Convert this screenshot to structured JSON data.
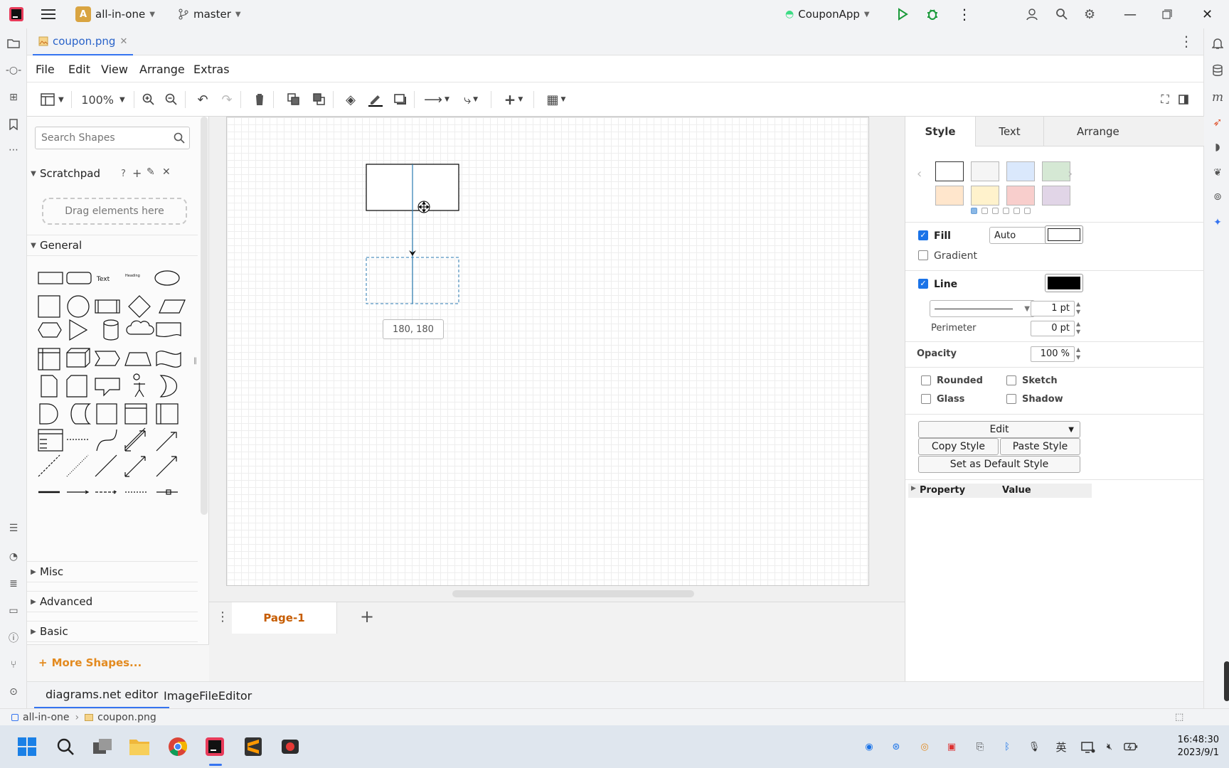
{
  "ide": {
    "project": "all-in-one",
    "project_badge": "A",
    "branch": "master",
    "run_config": "CouponApp"
  },
  "editor_tab": {
    "filename": "coupon.png"
  },
  "menu": [
    "File",
    "Edit",
    "View",
    "Arrange",
    "Extras"
  ],
  "toolbar": {
    "zoom": "100%"
  },
  "sidebar": {
    "search_placeholder": "Search Shapes",
    "scratchpad": {
      "title": "Scratchpad",
      "help": "?",
      "drop_hint": "Drag elements here"
    },
    "general": {
      "title": "General",
      "text_shape": "Text",
      "heading_shape": "Heading"
    },
    "collapsed_sections": [
      "Misc",
      "Advanced",
      "Basic"
    ],
    "more_shapes": "More Shapes..."
  },
  "canvas": {
    "size_tooltip": "180, 180"
  },
  "pages": {
    "tabs": [
      "Page-1"
    ]
  },
  "format": {
    "tabs": [
      "Style",
      "Text",
      "Arrange"
    ],
    "swatches": [
      "#ffffff",
      "#f5f5f5",
      "#dae8fc",
      "#d5e8d4",
      "#ffe6cc",
      "#fff2cc",
      "#f8cecc",
      "#e1d5e7"
    ],
    "fill": {
      "label": "Fill",
      "checked": true,
      "mode": "Auto",
      "color": "#ffffff"
    },
    "gradient": {
      "label": "Gradient",
      "checked": false
    },
    "line": {
      "label": "Line",
      "checked": true,
      "color": "#000000",
      "width": "1 pt"
    },
    "perimeter": {
      "label": "Perimeter",
      "value": "0 pt"
    },
    "opacity": {
      "label": "Opacity",
      "value": "100 %"
    },
    "options": {
      "rounded": "Rounded",
      "sketch": "Sketch",
      "glass": "Glass",
      "shadow": "Shadow"
    },
    "edit_label": "Edit",
    "copy_style": "Copy Style",
    "paste_style": "Paste Style",
    "set_default": "Set as Default Style",
    "property_header": "Property",
    "value_header": "Value"
  },
  "bottom_tabs": [
    "diagrams.net editor",
    "ImageFileEditor"
  ],
  "breadcrumb": [
    "all-in-one",
    "coupon.png"
  ],
  "taskbar": {
    "time": "16:48:30",
    "date": "2023/9/1",
    "ime": "英"
  }
}
